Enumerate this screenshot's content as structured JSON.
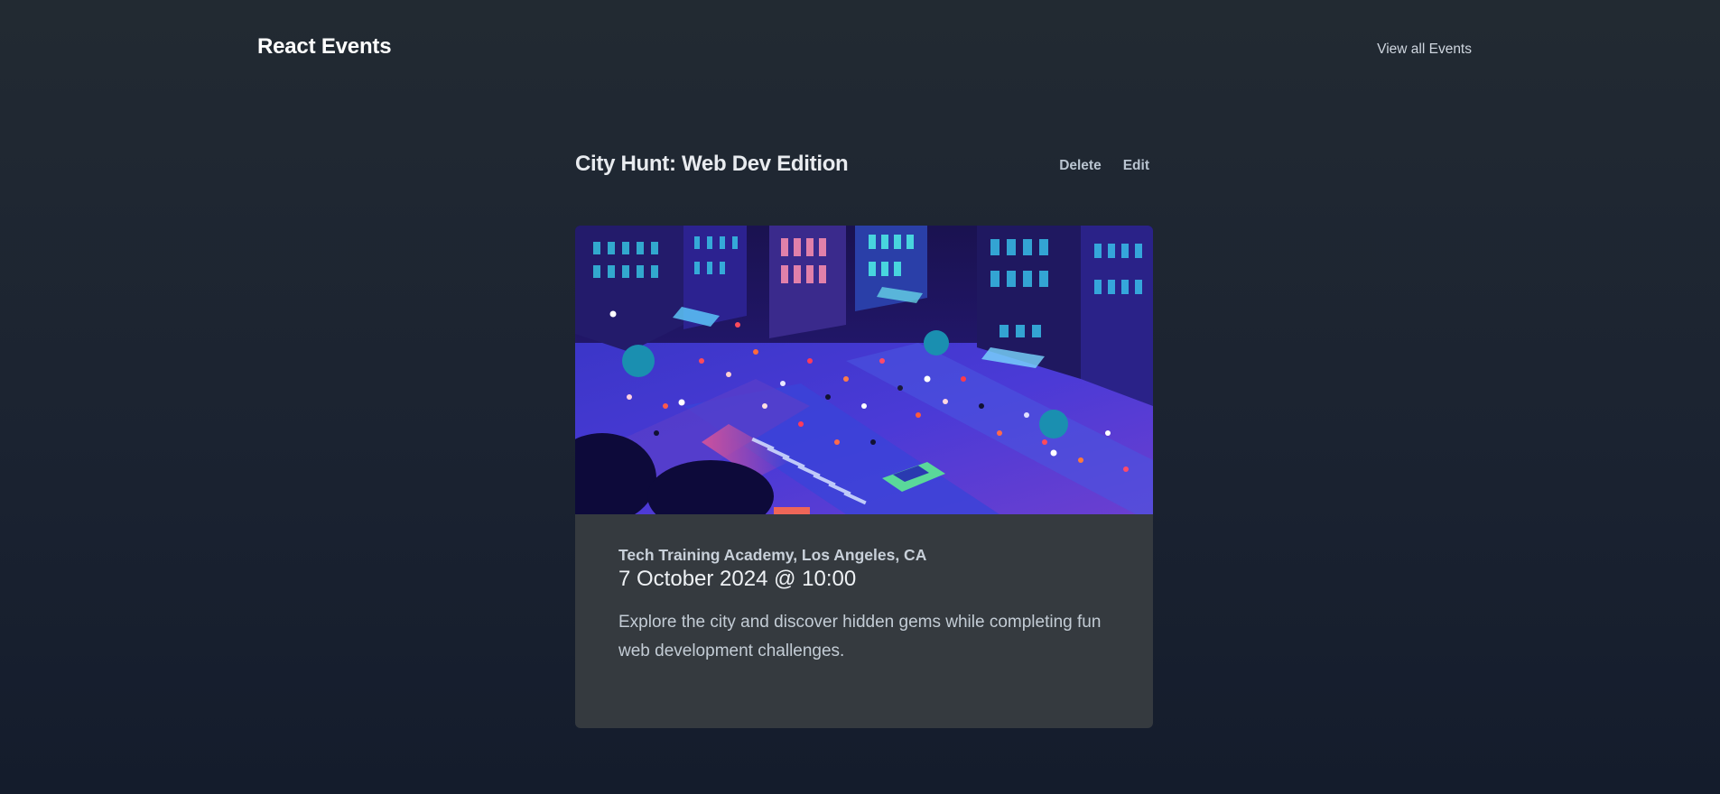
{
  "header": {
    "brand": "React Events",
    "nav_link": "View all Events"
  },
  "event": {
    "title": "City Hunt: Web Dev Edition",
    "actions": {
      "delete_label": "Delete",
      "edit_label": "Edit"
    },
    "image": {
      "semantic": "isometric-night-city-street-illustration"
    },
    "location": "Tech Training Academy, Los Angeles, CA",
    "datetime": "7 October 2024 @ 10:00",
    "description": "Explore the city and discover hidden gems while completing fun web development challenges."
  },
  "colors": {
    "background_top": "#222a32",
    "background_bottom": "#141c2c",
    "card_background": "#353a3f",
    "link_color": "#cfd6df"
  }
}
